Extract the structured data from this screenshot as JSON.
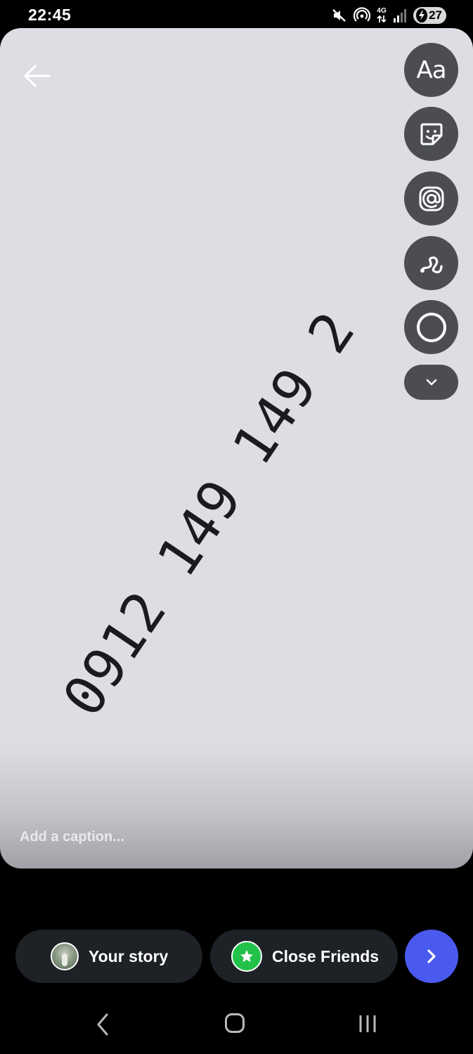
{
  "status_bar": {
    "time": "22:45",
    "network": "4G",
    "battery": "27",
    "icons": [
      "mute-icon",
      "hotspot-icon",
      "network-4g-icon",
      "signal-icon",
      "battery-charging-icon"
    ]
  },
  "editor": {
    "back_icon": "arrow-left-icon",
    "tools": [
      {
        "name": "text-tool",
        "label": "Aa"
      },
      {
        "name": "sticker-tool",
        "icon": "sticker-icon"
      },
      {
        "name": "mention-tool",
        "icon": "at-icon"
      },
      {
        "name": "draw-tool",
        "icon": "squiggle-icon"
      },
      {
        "name": "circle-tool",
        "icon": "circle-icon"
      },
      {
        "name": "more-tools",
        "icon": "chevron-down-icon"
      }
    ],
    "canvas_text": "0912 149 149 2",
    "caption_placeholder": "Add a caption..."
  },
  "share_bar": {
    "your_story_label": "Your story",
    "close_friends_label": "Close Friends",
    "next_icon": "chevron-right-icon"
  },
  "colors": {
    "canvas": "#dcdee3",
    "tool_button": "#4b4d52",
    "pill": "#1e2126",
    "close_friends_green": "#22c14a",
    "next_blue": "#4a5aef"
  }
}
